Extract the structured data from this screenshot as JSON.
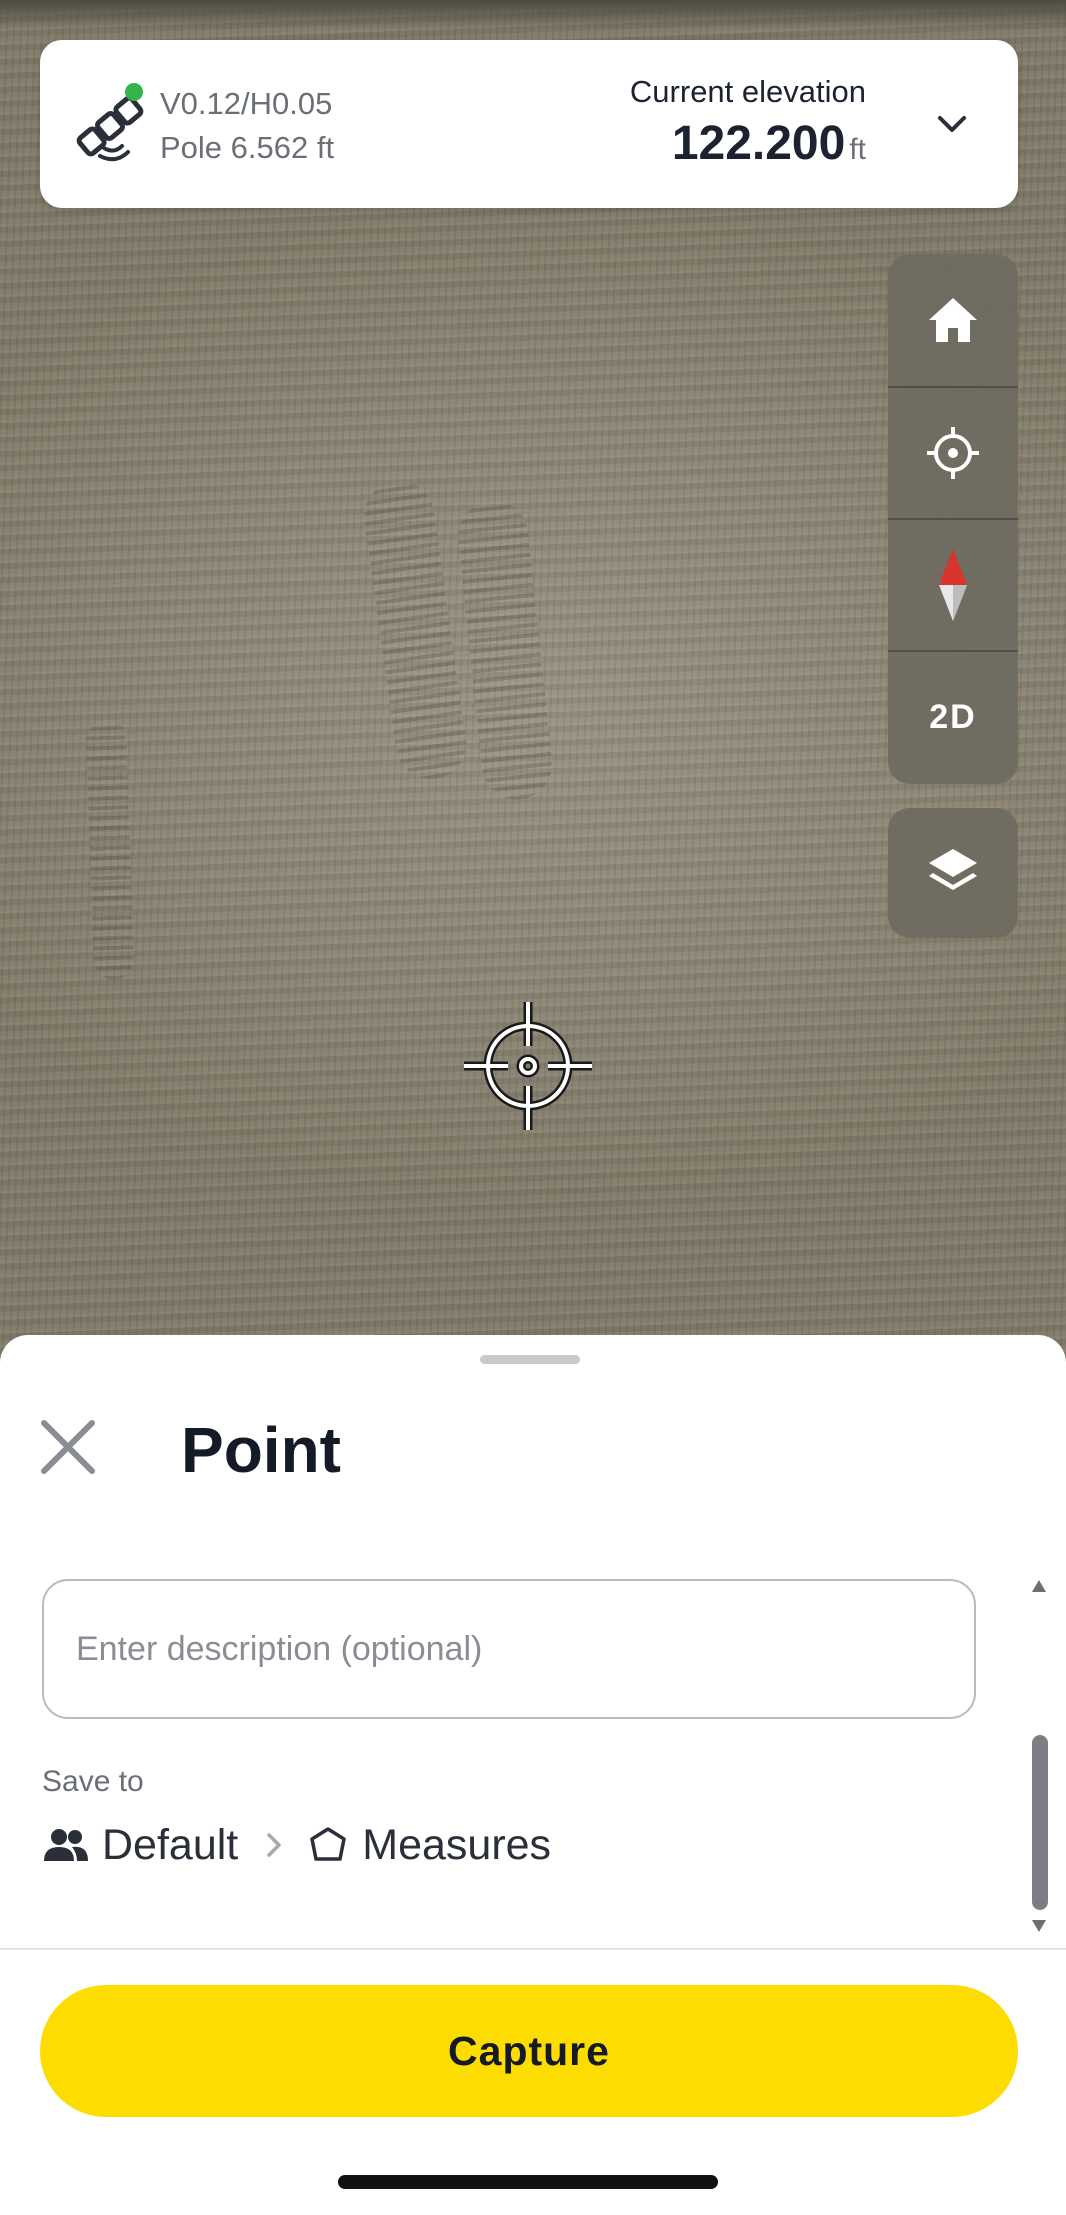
{
  "status_bar": {
    "precision": "V0.12/H0.05",
    "pole": "Pole 6.562 ft",
    "elevation_label": "Current elevation",
    "elevation_value": "122.200",
    "elevation_unit": "ft",
    "gnss_status_color": "#34b54a"
  },
  "map_controls": {
    "home": "home-icon",
    "locate": "locate-crosshair-icon",
    "compass": "compass-icon",
    "view_mode": "2D",
    "layers": "layers-icon"
  },
  "sheet": {
    "title": "Point",
    "description_placeholder": "Enter description (optional)",
    "description_value": "",
    "save_to_label": "Save to",
    "save_to_project": "Default",
    "save_to_layer": "Measures",
    "capture_label": "Capture"
  },
  "colors": {
    "accent": "#fddc02",
    "text_primary": "#151b26",
    "text_secondary": "#6b6f76",
    "compass_red": "#d9342b"
  }
}
